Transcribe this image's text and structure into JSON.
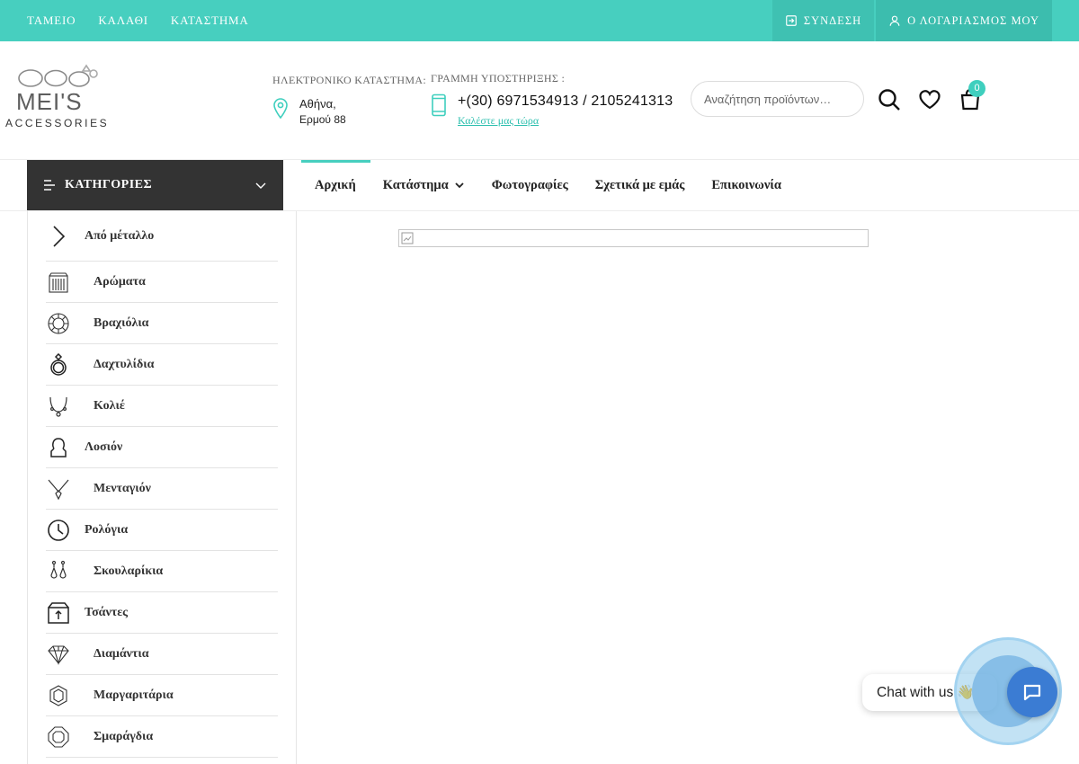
{
  "topbar": {
    "links": [
      "ΤΑΜΕΙΟ",
      "ΚΑΛΑΘΙ",
      "ΚΑΤΑΣΤΗΜΑ"
    ],
    "login_label": "ΣΥΝΔΕΣΗ",
    "account_label": "Ο ΛΟΓΑΡΙΑΣΜΟΣ ΜΟΥ"
  },
  "logo": {
    "brand": "MEI'S",
    "sub": "ACCESSORIES"
  },
  "store": {
    "label": "ΗΛΕΚΤΡΟΝΙΚΟ ΚΑΤΑΣΤΗΜΑ:",
    "city": "Αθήνα,",
    "street": "Ερμού 88"
  },
  "support": {
    "label": "ΓΡΑΜΜΗ ΥΠΟΣΤΗΡΙΞΗΣ :",
    "phone": "+(30) 6971534913 / 2105241313",
    "call_label": "Καλέστε μας τώρα"
  },
  "search": {
    "placeholder": "Αναζήτηση προϊόντων…"
  },
  "cart": {
    "count": "0"
  },
  "categories_button": {
    "label": "ΚΑΤΗΓΟΡΙΕΣ"
  },
  "nav": {
    "items": [
      "Αρχική",
      "Κατάστημα",
      "Φωτογραφίες",
      "Σχετικά με εμάς",
      "Επικοινωνία"
    ]
  },
  "sidebar": {
    "items": [
      {
        "label": "Από μέταλλο",
        "icon": "chevron-right-icon"
      },
      {
        "label": "Αρώματα",
        "icon": "perfume-icon"
      },
      {
        "label": "Βραχιόλια",
        "icon": "bracelet-icon"
      },
      {
        "label": "Δαχτυλίδια",
        "icon": "ring-icon"
      },
      {
        "label": "Κολιέ",
        "icon": "necklace-icon"
      },
      {
        "label": "Λοσιόν",
        "icon": "lotion-icon"
      },
      {
        "label": "Μενταγιόν",
        "icon": "pendant-icon"
      },
      {
        "label": "Ρολόγια",
        "icon": "clock-icon"
      },
      {
        "label": "Σκουλαρίκια",
        "icon": "earrings-icon"
      },
      {
        "label": "Τσάντες",
        "icon": "bag-icon"
      },
      {
        "label": "Διαμάντια",
        "icon": "diamond-icon"
      },
      {
        "label": "Μαργαριτάρια",
        "icon": "pearl-icon"
      },
      {
        "label": "Σμαράγδια",
        "icon": "emerald-icon"
      }
    ]
  },
  "chat": {
    "label": "Chat with us",
    "emoji": "👋"
  },
  "colors": {
    "accent": "#47cfbf",
    "dark": "#333333",
    "chat": "#3b7cd3"
  }
}
